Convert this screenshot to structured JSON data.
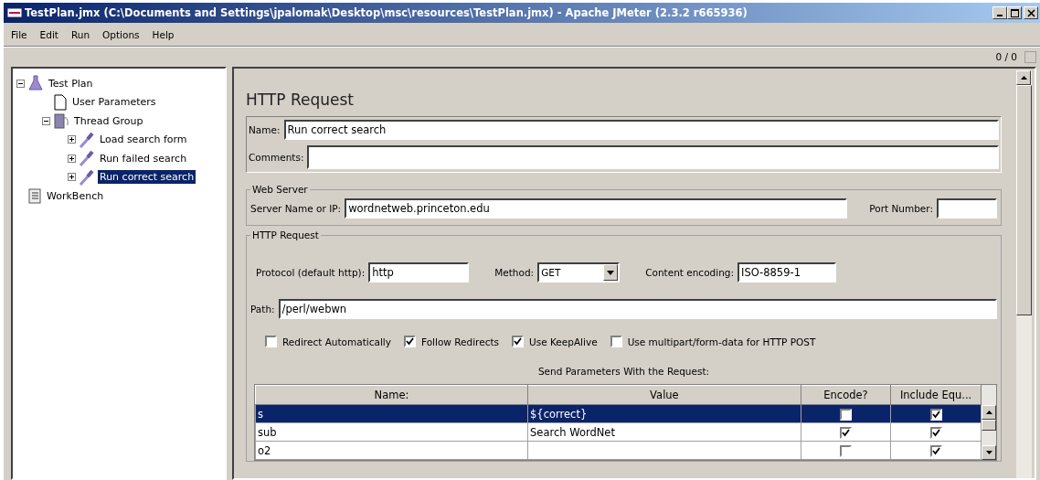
{
  "window": {
    "title": "TestPlan.jmx (C:\\Documents and Settings\\jpalomak\\Desktop\\msc\\resources\\TestPlan.jmx) - Apache JMeter (2.3.2 r665936)"
  },
  "menu": [
    "File",
    "Edit",
    "Run",
    "Options",
    "Help"
  ],
  "toolbar": {
    "counter": "0 / 0"
  },
  "tree": [
    {
      "label": "Test Plan",
      "kind": "plan",
      "expanded": true,
      "selected": false,
      "children": [
        {
          "label": "User Parameters",
          "kind": "params",
          "selected": false
        },
        {
          "label": "Thread Group",
          "kind": "group",
          "expanded": true,
          "selected": false,
          "children": [
            {
              "label": "Load search form",
              "kind": "sampler",
              "expanded": false,
              "selected": false
            },
            {
              "label": "Run failed search",
              "kind": "sampler",
              "expanded": false,
              "selected": false
            },
            {
              "label": "Run correct search",
              "kind": "sampler",
              "expanded": false,
              "selected": true
            }
          ]
        }
      ]
    },
    {
      "label": "WorkBench",
      "kind": "bench",
      "selected": false
    }
  ],
  "editor": {
    "title": "HTTP Request",
    "name": {
      "label": "Name:",
      "value": "Run correct search"
    },
    "comments": {
      "label": "Comments:"
    },
    "web_server": {
      "legend": "Web Server",
      "server_label": "Server Name or IP:",
      "server_value": "wordnetweb.princeton.edu",
      "port_label": "Port Number:"
    },
    "http_request": {
      "legend": "HTTP Request",
      "protocol_label": "Protocol (default http):",
      "protocol_value": "http",
      "method_label": "Method:",
      "method_value": "GET",
      "encoding_label": "Content encoding:",
      "encoding_value": "ISO-8859-1",
      "path_label": "Path:",
      "path_value": "/perl/webwn",
      "options": [
        {
          "label": "Redirect Automatically",
          "checked": false
        },
        {
          "label": "Follow Redirects",
          "checked": true
        },
        {
          "label": "Use KeepAlive",
          "checked": true
        },
        {
          "label": "Use multipart/form-data for HTTP POST",
          "checked": false
        }
      ],
      "params_title": "Send Parameters With the Request:",
      "table": {
        "columns": [
          "Name:",
          "Value",
          "Encode?",
          "Include Equ..."
        ],
        "rows": [
          {
            "name": "s",
            "value": "${correct}",
            "encode": false,
            "include_equals": true,
            "selected": true
          },
          {
            "name": "sub",
            "value": "Search WordNet",
            "encode": true,
            "include_equals": true,
            "selected": false
          },
          {
            "name": "o2",
            "encode": false,
            "include_equals": true,
            "selected": false
          }
        ]
      }
    }
  }
}
